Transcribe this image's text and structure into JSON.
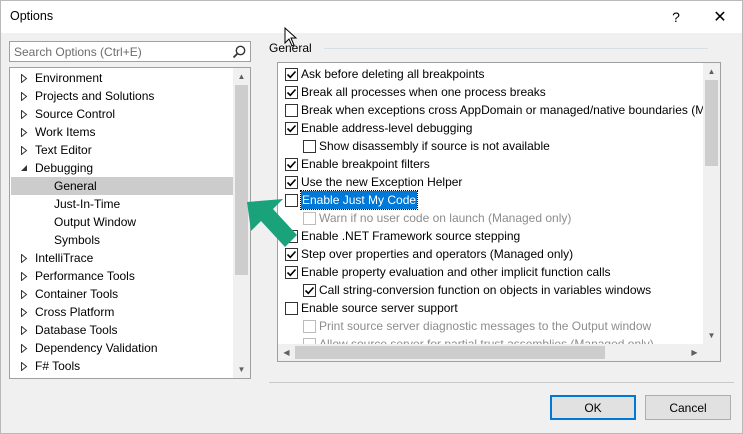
{
  "window": {
    "title": "Options",
    "help": "?",
    "close": "✕"
  },
  "search": {
    "placeholder": "Search Options (Ctrl+E)"
  },
  "tree": {
    "items": [
      {
        "label": "Environment",
        "expandable": true,
        "expanded": false,
        "level": 0
      },
      {
        "label": "Projects and Solutions",
        "expandable": true,
        "expanded": false,
        "level": 0
      },
      {
        "label": "Source Control",
        "expandable": true,
        "expanded": false,
        "level": 0
      },
      {
        "label": "Work Items",
        "expandable": true,
        "expanded": false,
        "level": 0
      },
      {
        "label": "Text Editor",
        "expandable": true,
        "expanded": false,
        "level": 0
      },
      {
        "label": "Debugging",
        "expandable": true,
        "expanded": true,
        "level": 0
      },
      {
        "label": "General",
        "expandable": false,
        "level": 1,
        "selected": true
      },
      {
        "label": "Just-In-Time",
        "expandable": false,
        "level": 1
      },
      {
        "label": "Output Window",
        "expandable": false,
        "level": 1
      },
      {
        "label": "Symbols",
        "expandable": false,
        "level": 1
      },
      {
        "label": "IntelliTrace",
        "expandable": true,
        "expanded": false,
        "level": 0
      },
      {
        "label": "Performance Tools",
        "expandable": true,
        "expanded": false,
        "level": 0
      },
      {
        "label": "Container Tools",
        "expandable": true,
        "expanded": false,
        "level": 0
      },
      {
        "label": "Cross Platform",
        "expandable": true,
        "expanded": false,
        "level": 0
      },
      {
        "label": "Database Tools",
        "expandable": true,
        "expanded": false,
        "level": 0
      },
      {
        "label": "Dependency Validation",
        "expandable": true,
        "expanded": false,
        "level": 0
      },
      {
        "label": "F# Tools",
        "expandable": true,
        "expanded": false,
        "level": 0
      }
    ]
  },
  "section": {
    "title": "General"
  },
  "options": [
    {
      "label": "Ask before deleting all breakpoints",
      "checked": true,
      "indent": 0
    },
    {
      "label": "Break all processes when one process breaks",
      "checked": true,
      "indent": 0
    },
    {
      "label": "Break when exceptions cross AppDomain or managed/native boundaries (Ma",
      "checked": false,
      "indent": 0
    },
    {
      "label": "Enable address-level debugging",
      "checked": true,
      "indent": 0
    },
    {
      "label": "Show disassembly if source is not available",
      "checked": false,
      "indent": 1
    },
    {
      "label": "Enable breakpoint filters",
      "checked": true,
      "indent": 0
    },
    {
      "label": "Use the new Exception Helper",
      "checked": true,
      "indent": 0
    },
    {
      "label": "Enable Just My Code",
      "checked": false,
      "indent": 0,
      "focused": true
    },
    {
      "label": "Warn if no user code on launch (Managed only)",
      "checked": false,
      "indent": 1,
      "disabled": true
    },
    {
      "label": "Enable .NET Framework source stepping",
      "checked": false,
      "indent": 0
    },
    {
      "label": "Step over properties and operators (Managed only)",
      "checked": true,
      "indent": 0
    },
    {
      "label": "Enable property evaluation and other implicit function calls",
      "checked": true,
      "indent": 0
    },
    {
      "label": "Call string-conversion function on objects in variables windows",
      "checked": true,
      "indent": 1
    },
    {
      "label": "Enable source server support",
      "checked": false,
      "indent": 0
    },
    {
      "label": "Print source server diagnostic messages to the Output window",
      "checked": false,
      "indent": 1,
      "disabled": true
    },
    {
      "label": "Allow source server for partial trust assemblies (Managed only)",
      "checked": false,
      "indent": 1,
      "disabled": true
    }
  ],
  "buttons": {
    "ok": "OK",
    "cancel": "Cancel"
  },
  "colors": {
    "accent": "#0078d7",
    "annotation_arrow": "#1aa37a",
    "selected_tree_bg": "#cccccc"
  }
}
